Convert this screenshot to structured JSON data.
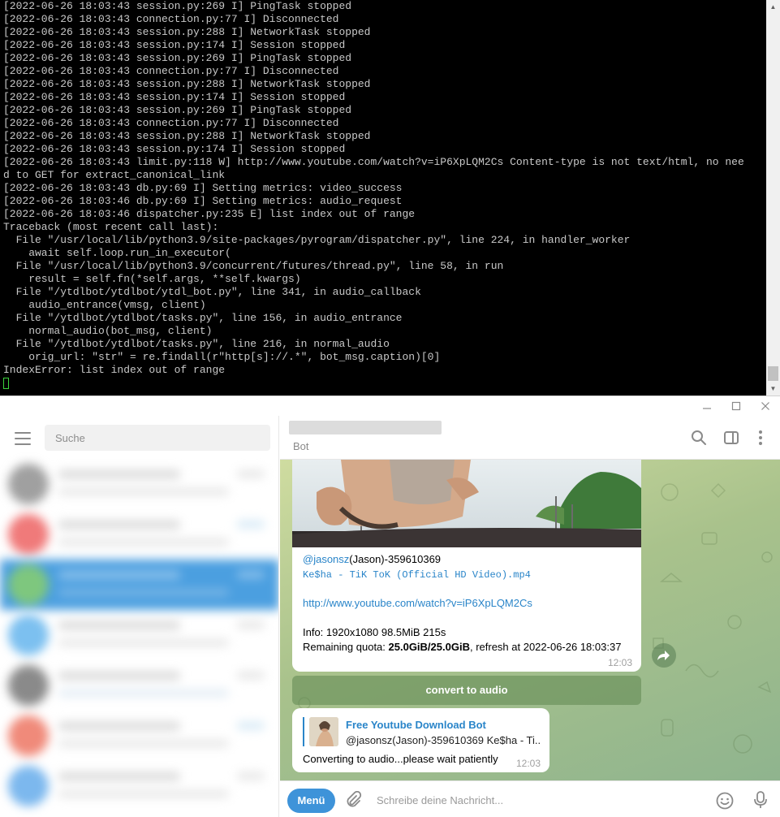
{
  "terminal": {
    "lines": [
      "[2022-06-26 18:03:43 session.py:269 I] PingTask stopped",
      "[2022-06-26 18:03:43 connection.py:77 I] Disconnected",
      "[2022-06-26 18:03:43 session.py:288 I] NetworkTask stopped",
      "[2022-06-26 18:03:43 session.py:174 I] Session stopped",
      "[2022-06-26 18:03:43 session.py:269 I] PingTask stopped",
      "[2022-06-26 18:03:43 connection.py:77 I] Disconnected",
      "[2022-06-26 18:03:43 session.py:288 I] NetworkTask stopped",
      "[2022-06-26 18:03:43 session.py:174 I] Session stopped",
      "[2022-06-26 18:03:43 session.py:269 I] PingTask stopped",
      "[2022-06-26 18:03:43 connection.py:77 I] Disconnected",
      "[2022-06-26 18:03:43 session.py:288 I] NetworkTask stopped",
      "[2022-06-26 18:03:43 session.py:174 I] Session stopped",
      "[2022-06-26 18:03:43 limit.py:118 W] http://www.youtube.com/watch?v=iP6XpLQM2Cs Content-type is not text/html, no nee",
      "d to GET for extract_canonical_link",
      "[2022-06-26 18:03:43 db.py:69 I] Setting metrics: video_success",
      "[2022-06-26 18:03:46 db.py:69 I] Setting metrics: audio_request",
      "[2022-06-26 18:03:46 dispatcher.py:235 E] list index out of range",
      "Traceback (most recent call last):",
      "  File \"/usr/local/lib/python3.9/site-packages/pyrogram/dispatcher.py\", line 224, in handler_worker",
      "    await self.loop.run_in_executor(",
      "  File \"/usr/local/lib/python3.9/concurrent/futures/thread.py\", line 58, in run",
      "    result = self.fn(*self.args, **self.kwargs)",
      "  File \"/ytdlbot/ytdlbot/ytdl_bot.py\", line 341, in audio_callback",
      "    audio_entrance(vmsg, client)",
      "  File \"/ytdlbot/ytdlbot/tasks.py\", line 156, in audio_entrance",
      "    normal_audio(bot_msg, client)",
      "  File \"/ytdlbot/ytdlbot/tasks.py\", line 216, in normal_audio",
      "    orig_url: \"str\" = re.findall(r\"http[s]://.*\", bot_msg.caption)[0]",
      "IndexError: list index out of range"
    ]
  },
  "sidebar": {
    "search_placeholder": "Suche"
  },
  "chat": {
    "status": "Bot",
    "video_message": {
      "mention": "@jasonsz",
      "sender_suffix": "(Jason)-359610369",
      "filename": "Ke$ha - TiK ToK (Official HD Video).mp4",
      "url": "http://www.youtube.com/watch?v=iP6XpLQM2Cs",
      "info": "Info: 1920x1080 98.5MiB 215s",
      "quota_prefix": "Remaining quota: ",
      "quota_value": "25.0GiB/25.0GiB",
      "quota_suffix": ", refresh at 2022-06-26 18:03:37",
      "time": "12:03"
    },
    "inline_button": "convert to audio",
    "reply_message": {
      "reply_title": "Free Youtube Download Bot",
      "reply_preview": "@jasonsz(Jason)-359610369 Ke$ha - Ti...",
      "text": "Converting to audio...please wait patiently",
      "time": "12:03"
    }
  },
  "input_bar": {
    "menu_label": "Menü",
    "placeholder": "Schreibe deine Nachricht..."
  },
  "colors": {
    "accent": "#3e93d9",
    "link": "#2a85c9",
    "selected_chat": "#4b9fe0"
  }
}
